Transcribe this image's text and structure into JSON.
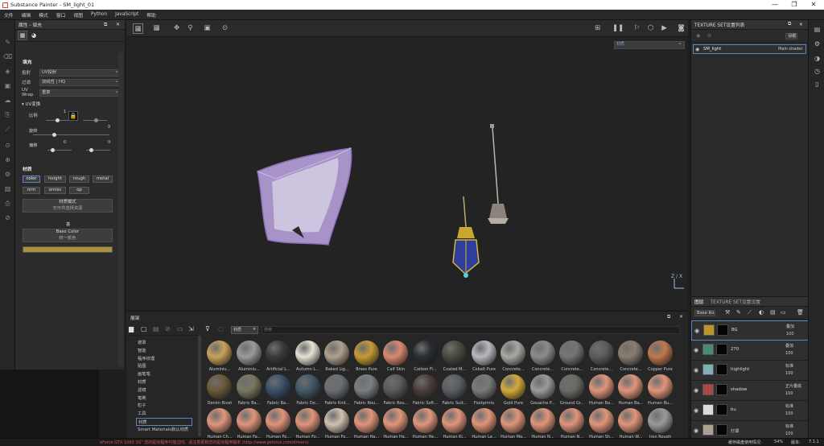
{
  "window": {
    "title": "Substance Painter - SM_light_01",
    "minimize": "—",
    "maximize": "❐",
    "close": "✕"
  },
  "menu": [
    "文件",
    "编辑",
    "模式",
    "窗口",
    "视图",
    "Python",
    "JavaScript",
    "帮助"
  ],
  "properties": {
    "header": "属性 - 填充",
    "section_fill": "填充",
    "mapping_label": "投射",
    "mapping_value": "UV投射",
    "filtering_label": "过滤",
    "filtering_value": "双线性 | HQ",
    "uvwrap_label": "UV Wrap",
    "uvwrap_value": "重复",
    "uv_transform": "UV变换",
    "scale_label": "比例",
    "scale_value": "1",
    "rotation_label": "旋转",
    "rotation_value": "0",
    "offset_label": "偏移",
    "offset_x": "0",
    "offset_y": "0",
    "material_section": "材质",
    "channels": [
      "color",
      "height",
      "rough",
      "metal",
      "nrm",
      "emiss",
      "op"
    ],
    "material_mode_title": "材质模式",
    "material_mode_sub": "无可供选择资源",
    "base_color_section": "基",
    "base_color_title": "Base Color",
    "base_color_sub": "统一颜色",
    "base_color_hex": "#a8913a"
  },
  "viewport": {
    "channel_dropdown": "材质",
    "axis": "Z / X"
  },
  "texture_set_list": {
    "header": "TEXTURE SET设置列表",
    "settings_label": "设置",
    "item_name": "SM_light",
    "item_shader": "Main shader"
  },
  "layers": {
    "tab_layers": "图层",
    "tab_settings": "TEXTURE SET设置设置",
    "blend_dropdown": "Base Co",
    "rows": [
      {
        "name": "BG",
        "blend": "叠加",
        "opacity": "100",
        "thumb": "#b8962c",
        "selected": true
      },
      {
        "name": "270",
        "blend": "叠加",
        "opacity": "100",
        "thumb": "#4c8a7a",
        "selected": false
      },
      {
        "name": "highlight",
        "blend": "标准",
        "opacity": "100",
        "thumb": "#7fb0b8",
        "selected": false
      },
      {
        "name": "shadow",
        "blend": "正片叠底",
        "opacity": "100",
        "thumb": "#a84848",
        "selected": false
      },
      {
        "name": "bu",
        "blend": "标准",
        "opacity": "100",
        "thumb": "#dcdcdc",
        "selected": false
      },
      {
        "name": "灯罩",
        "blend": "标准",
        "opacity": "100",
        "thumb": "#b0a090",
        "selected": false
      }
    ]
  },
  "shelf": {
    "header": "展架",
    "search_placeholder": "搜索",
    "filter_tag": "材质",
    "categories": [
      "遮罩",
      "智能",
      "程序纹理",
      "贴图",
      "画笔笔",
      "材质",
      "滤镜",
      "笔刷",
      "粒子",
      "工具",
      "材质",
      "Smart Materials默认材质"
    ],
    "materials_row1": [
      {
        "name": "Aluminiu...",
        "color": "#c9a25a"
      },
      {
        "name": "Aluminiu...",
        "color": "#9a9a9a"
      },
      {
        "name": "Artificial L...",
        "color": "#3a3a3a"
      },
      {
        "name": "Autumn L...",
        "color": "#e8e0d4"
      },
      {
        "name": "Baked Lig...",
        "color": "#b0a090"
      },
      {
        "name": "Brass Pure",
        "color": "#c69a36"
      },
      {
        "name": "Calf Skin",
        "color": "#d98a70"
      },
      {
        "name": "Carbon Fi...",
        "color": "#2a2e34"
      },
      {
        "name": "Coated M...",
        "color": "#4a4a40"
      },
      {
        "name": "Cobalt Pure",
        "color": "#b8b8c0"
      },
      {
        "name": "Concrete...",
        "color": "#a8a8a4"
      },
      {
        "name": "Concrete...",
        "color": "#8c8c8a"
      },
      {
        "name": "Concrete...",
        "color": "#757575"
      },
      {
        "name": "Concrete...",
        "color": "#5c5c5c"
      },
      {
        "name": "Concrete...",
        "color": "#8a7c70"
      },
      {
        "name": "Copper Pure",
        "color": "#c07850"
      }
    ],
    "materials_row2": [
      {
        "name": "Denim Rivet",
        "color": "#6a5a3a"
      },
      {
        "name": "Fabric Ba...",
        "color": "#7a7860"
      },
      {
        "name": "Fabric Ba...",
        "color": "#3a5068"
      },
      {
        "name": "Fabric De...",
        "color": "#425868"
      },
      {
        "name": "Fabric Knit...",
        "color": "#6a6e74"
      },
      {
        "name": "Fabric Rou...",
        "color": "#7a7e84"
      },
      {
        "name": "Fabric Rou...",
        "color": "#5a5a5a"
      },
      {
        "name": "Fabric Soft...",
        "color": "#4a3e38"
      },
      {
        "name": "Fabric Suit...",
        "color": "#5a5e64"
      },
      {
        "name": "Footprints",
        "color": "#7a7a7a"
      },
      {
        "name": "Gold Pure",
        "color": "#d4aa3c"
      },
      {
        "name": "Gouache P...",
        "color": "#9a9a9a"
      },
      {
        "name": "Ground Gr...",
        "color": "#6a6a66"
      },
      {
        "name": "Human Ba...",
        "color": "#e0957a"
      },
      {
        "name": "Human Ba...",
        "color": "#e0957a"
      },
      {
        "name": "Human Bu...",
        "color": "#e0957a"
      }
    ],
    "materials_row3": [
      {
        "name": "Human Ch...",
        "color": "#e0957a"
      },
      {
        "name": "Human Fa...",
        "color": "#e0957a"
      },
      {
        "name": "Human Fe...",
        "color": "#e0957a"
      },
      {
        "name": "Human Fo...",
        "color": "#e0957a"
      },
      {
        "name": "Human Fo...",
        "color": "#cfc2b0"
      },
      {
        "name": "Human Ha...",
        "color": "#e0957a"
      },
      {
        "name": "Human Ha...",
        "color": "#e0957a"
      },
      {
        "name": "Human He...",
        "color": "#e0957a"
      },
      {
        "name": "Human Ki...",
        "color": "#e0957a"
      },
      {
        "name": "Human Le...",
        "color": "#e0957a"
      },
      {
        "name": "Human Ma...",
        "color": "#e0957a"
      },
      {
        "name": "Human N...",
        "color": "#e0957a"
      },
      {
        "name": "Human N...",
        "color": "#e0957a"
      },
      {
        "name": "Human Sh...",
        "color": "#e0957a"
      },
      {
        "name": "Human W...",
        "color": "#e0957a"
      },
      {
        "name": "Iron Rough",
        "color": "#9a9a9a"
      }
    ]
  },
  "status": {
    "warning": "eForce GTX 1060 3G\" 您的驱动程序可能过时。请注意更新您的驱动程序版本 (http://www.geforce.com/drivers)",
    "cache": "缓存磁盘使用情况:",
    "percent": "54%",
    "version_label": "版本:",
    "version": "7.1.1"
  }
}
